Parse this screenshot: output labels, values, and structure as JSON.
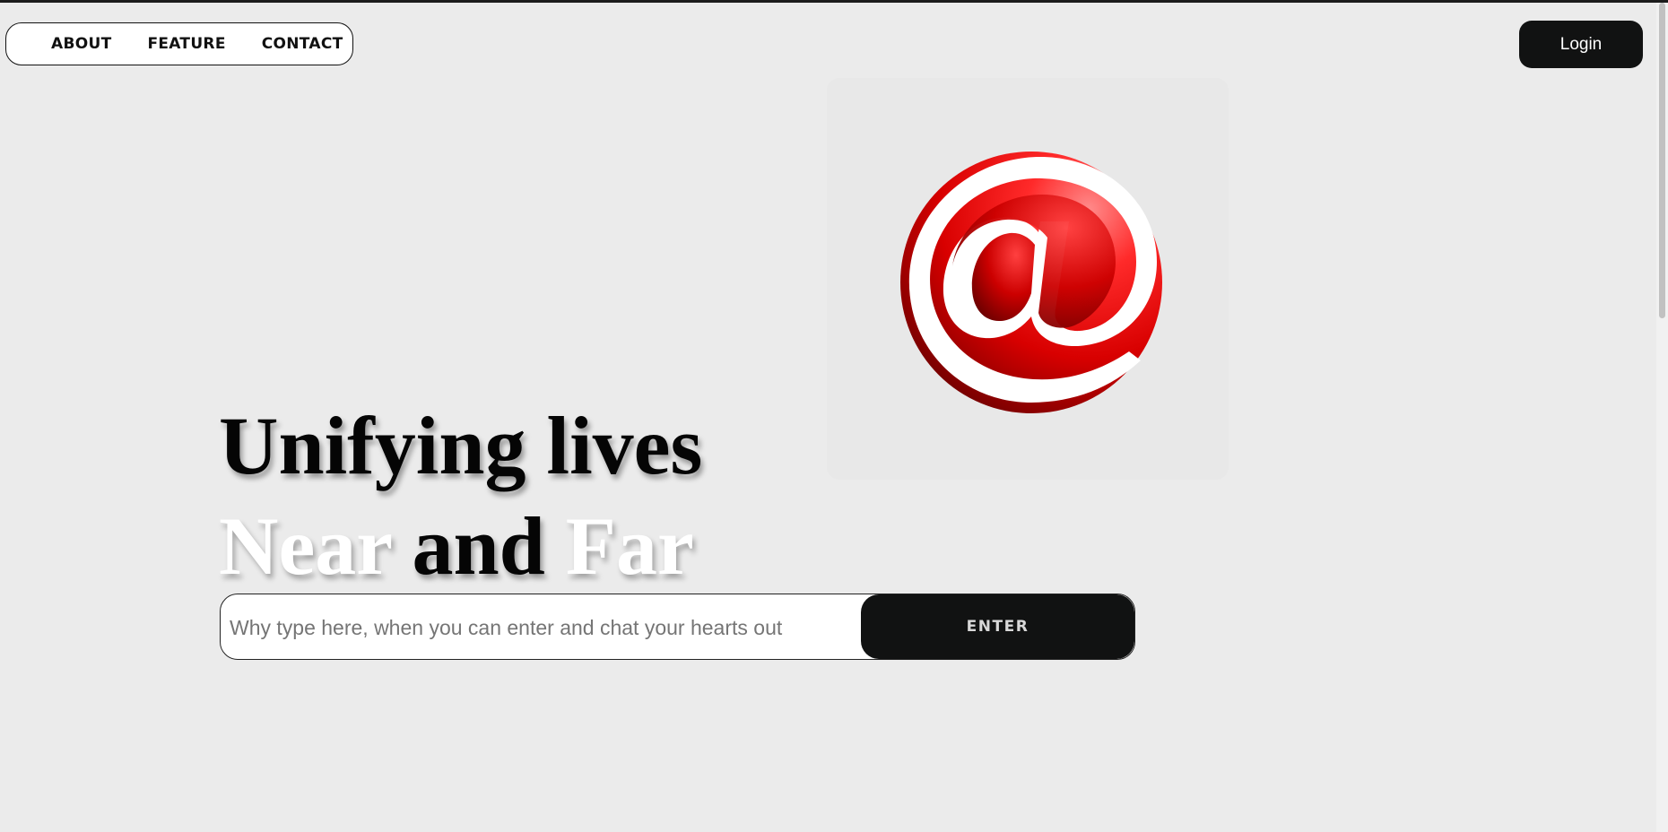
{
  "nav": {
    "items": [
      {
        "label": "ABOUT"
      },
      {
        "label": "FEATURE"
      },
      {
        "label": "CONTACT"
      }
    ]
  },
  "header": {
    "login_label": "Login"
  },
  "logo": {
    "icon": "at-sign-icon",
    "glyph": "@",
    "colors": {
      "primary": "#e60000",
      "dark": "#6b0000",
      "light": "#ff7a7a"
    }
  },
  "hero": {
    "line1": "Unifying lives",
    "line2": {
      "word1": "Near",
      "word2": "and",
      "word3": "Far"
    }
  },
  "entry": {
    "placeholder": "Why type here, when you can enter and chat your hearts out",
    "value": "",
    "button_label": "ENTER"
  },
  "theme": {
    "background": "#ebebeb",
    "button_bg": "#111212"
  }
}
